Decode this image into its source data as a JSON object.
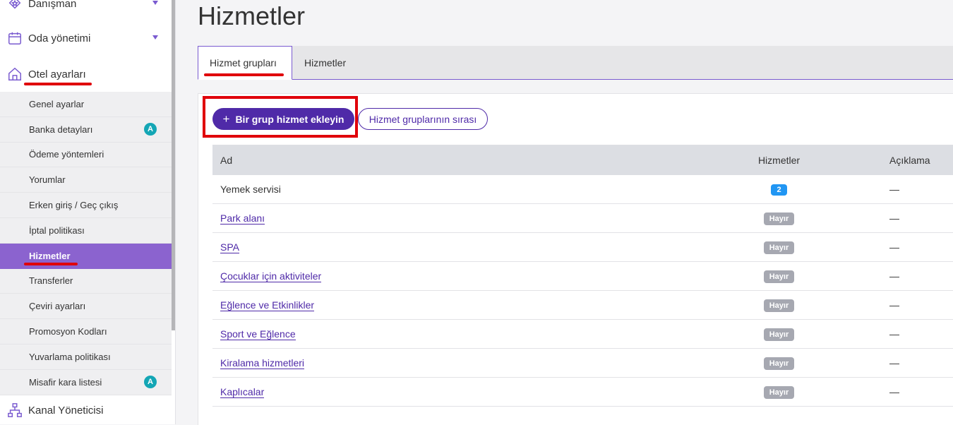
{
  "sidebar": {
    "top_items": [
      {
        "label": "Danışman",
        "icon": "shield-star-icon"
      },
      {
        "label": "Oda yönetimi",
        "icon": "calendar-icon"
      },
      {
        "label": "Otel ayarları",
        "icon": "home-icon"
      }
    ],
    "sub_items": [
      {
        "label": "Genel ayarlar"
      },
      {
        "label": "Banka detayları",
        "badge": "A"
      },
      {
        "label": "Ödeme yöntemleri"
      },
      {
        "label": "Yorumlar"
      },
      {
        "label": "Erken giriş / Geç çıkış"
      },
      {
        "label": "İptal politikası"
      },
      {
        "label": "Hizmetler",
        "active": true
      },
      {
        "label": "Transferler"
      },
      {
        "label": "Çeviri ayarları"
      },
      {
        "label": "Promosyon Kodları"
      },
      {
        "label": "Yuvarlama politikası"
      },
      {
        "label": "Misafir kara listesi",
        "badge": "A"
      }
    ],
    "bottom_item": {
      "label": "Kanal Yöneticisi",
      "icon": "sitemap-icon"
    }
  },
  "main": {
    "title": "Hizmetler",
    "tabs": [
      {
        "label": "Hizmet grupları",
        "active": true
      },
      {
        "label": "Hizmetler"
      }
    ],
    "add_button": "Bir grup hizmet ekleyin",
    "add_button_icon": "+",
    "order_button": "Hizmet gruplarının sırası",
    "table": {
      "headers": [
        "Ad",
        "Hizmetler",
        "Açıklama"
      ],
      "rows": [
        {
          "name": "Yemek servisi",
          "services": "2",
          "description": "—"
        },
        {
          "name": "Park alanı",
          "services": "Hayır",
          "description": "—"
        },
        {
          "name": "SPA",
          "services": "Hayır",
          "description": "—"
        },
        {
          "name": "Çocuklar için aktiviteler",
          "services": "Hayır",
          "description": "—"
        },
        {
          "name": "Eğlence ve Etkinlikler",
          "services": "Hayır",
          "description": "—"
        },
        {
          "name": "Sport ve Eğlence",
          "services": "Hayır",
          "description": "—"
        },
        {
          "name": "Kiralama hizmetleri",
          "services": "Hayır",
          "description": "—"
        },
        {
          "name": "Kaplıcalar",
          "services": "Hayır",
          "description": "—"
        }
      ]
    }
  },
  "colors": {
    "accent": "#4f2aa8",
    "active_nav": "#8b63cf",
    "highlight_red": "#e0000a",
    "badge_teal": "#14a6b5",
    "count_blue": "#2196f3",
    "no_grey": "#a6a8b1"
  }
}
